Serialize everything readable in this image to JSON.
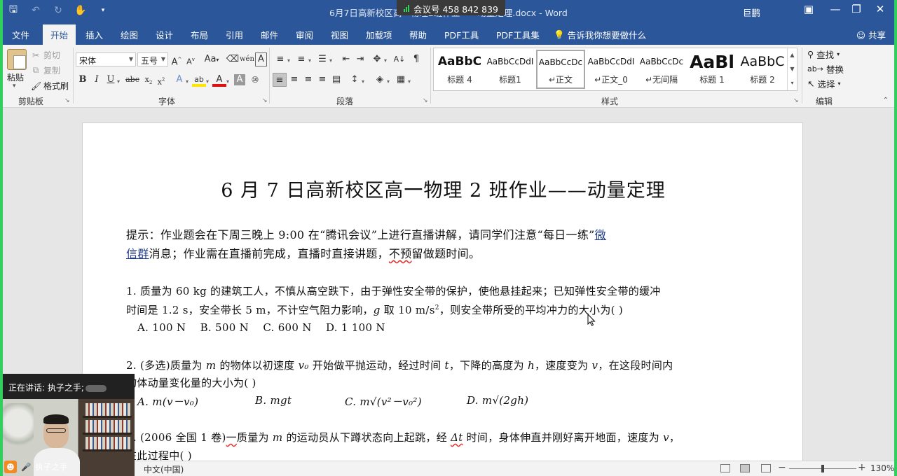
{
  "window": {
    "doc_title": "6月7日高新校区高一物理2班作业——动量定理.docx - Word",
    "meeting_id": "会议号 458 842 839",
    "user": "巨鹏"
  },
  "tabs": [
    "文件",
    "开始",
    "插入",
    "绘图",
    "设计",
    "布局",
    "引用",
    "邮件",
    "审阅",
    "视图",
    "加载项",
    "帮助",
    "PDF工具",
    "PDF工具集"
  ],
  "tell_me": "告诉我你想要做什么",
  "share": "共享",
  "clipboard": {
    "paste": "粘贴",
    "cut": "剪切",
    "copy": "复制",
    "format_painter": "格式刷",
    "label": "剪贴板"
  },
  "font": {
    "name": "宋体",
    "size": "五号",
    "label": "字体"
  },
  "paragraph": {
    "label": "段落"
  },
  "styles": {
    "label": "样式",
    "items": [
      {
        "sample": "AaBbC",
        "name": "标题 4"
      },
      {
        "sample": "AaBbCcDdI",
        "name": "标题1"
      },
      {
        "sample": "AaBbCcDc",
        "name": "正文"
      },
      {
        "sample": "AaBbCcDdI",
        "name": "正文_0"
      },
      {
        "sample": "AaBbCcDc",
        "name": "无间隔"
      },
      {
        "sample": "AaBl",
        "name": "标题 1"
      },
      {
        "sample": "AaBbC",
        "name": "标题 2"
      }
    ]
  },
  "editing": {
    "find": "查找",
    "replace": "替换",
    "select": "选择",
    "label": "编辑"
  },
  "document": {
    "title": "6 月 7 日高新校区高一物理 2 班作业——动量定理",
    "notice_1a": "提示：作业题会在下周三晚上 9:00 在“腾讯会议”上进行直播讲解，请同学们注意“每日一练”",
    "notice_1b": "微",
    "notice_2a": "信群",
    "notice_2b": "消息；作业需在直播前完成，直播时直接讲题，",
    "notice_2c": "不预",
    "notice_2d": "留做题时间。",
    "q1_line1": "1. 质量为 60 kg 的建筑工人，不慎从高空跌下，由于弹性安全带的保护，使他悬挂起来；已知弹性安全带的缓冲",
    "q1_line2a": "时间是 1.2 s，安全带长 5 m，不计空气阻力影响，",
    "q1_g": "g",
    "q1_line2b": " 取 10 m/s",
    "q1_sup": "2",
    "q1_line2c": "，则安全带所受的平均冲力的大小为(      )",
    "q1_options": "A. 100 N    B. 500 N    C. 600 N    D. 1 100 N",
    "q2_line1a": "2. (多选)质量为 ",
    "q2_m": "m",
    "q2_line1b": " 的物体以初速度 ",
    "q2_v0": "v₀",
    "q2_line1c": " 开始做平抛运动，经过时间 ",
    "q2_t": "t",
    "q2_line1d": "，下降的高度为 ",
    "q2_h": "h",
    "q2_line1e": "，速度变为 ",
    "q2_v": "v",
    "q2_line1f": "，在这段时间内",
    "q2_line2": "物体动量变化量的大小为(      )",
    "q2_opt_a": "A. m(v－v₀)",
    "q2_opt_b": "B. mgt",
    "q2_opt_c": "C. m√(v²－v₀²)",
    "q2_opt_d": "D. m√(2gh)",
    "q3_line1a": "3. (2006 全国 1 卷)",
    "q3_line1b": "一",
    "q3_line1c": "质量为 ",
    "q3_m": "m",
    "q3_line1d": " 的运动员从下蹲状态向上起跳，经 ",
    "q3_dt": "Δt",
    "q3_line1e": " 时间，身体伸直并刚好离开地面，速度为 ",
    "q3_v": "v",
    "q3_line1f": "，",
    "q3_line2": "在此过程中(      )"
  },
  "video": {
    "speaking_label": "正在讲话: 执子之手;",
    "participant": "执子之手"
  },
  "status": {
    "language": "中文(中国)",
    "zoom": "130%",
    "zoom_fraction": 0.5
  }
}
